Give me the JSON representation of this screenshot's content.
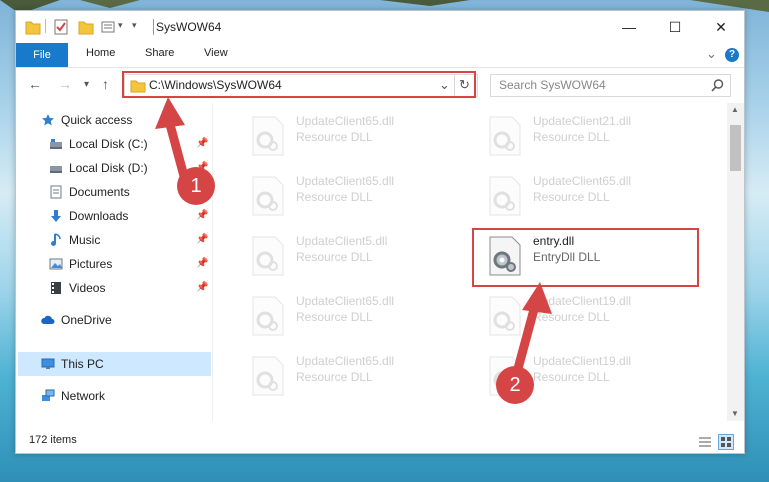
{
  "window": {
    "title": "SysWOW64",
    "controls": {
      "minimize": "—",
      "maximize": "☐",
      "close": "✕"
    }
  },
  "ribbon": {
    "tabs": [
      "File",
      "Home",
      "Share",
      "View"
    ],
    "expand_glyph": "⌄",
    "help_glyph": "?"
  },
  "nav": {
    "back": "←",
    "forward": "→",
    "recent": "▾",
    "up": "↑",
    "address": "C:\\Windows\\SysWOW64",
    "address_dropdown": "⌄",
    "refresh": "↻",
    "search_placeholder": "Search SysWOW64"
  },
  "sidebar": {
    "items": [
      {
        "label": "Quick access",
        "icon": "star-icon",
        "pinned": false
      },
      {
        "label": "Local Disk (C:)",
        "icon": "drive-icon",
        "pinned": true
      },
      {
        "label": "Local Disk (D:)",
        "icon": "drive-icon",
        "pinned": true
      },
      {
        "label": "Documents",
        "icon": "documents-icon",
        "pinned": true
      },
      {
        "label": "Downloads",
        "icon": "download-icon",
        "pinned": true
      },
      {
        "label": "Music",
        "icon": "music-icon",
        "pinned": true
      },
      {
        "label": "Pictures",
        "icon": "pictures-icon",
        "pinned": true
      },
      {
        "label": "Videos",
        "icon": "videos-icon",
        "pinned": true
      },
      {
        "label": "OneDrive",
        "icon": "cloud-icon",
        "pinned": false
      },
      {
        "label": "This PC",
        "icon": "computer-icon",
        "pinned": false,
        "selected": true
      },
      {
        "label": "Network",
        "icon": "network-icon",
        "pinned": false
      }
    ],
    "pin_glyph": "📌"
  },
  "files": [
    {
      "name": "UpdateClient65.dll",
      "type": "Resource DLL",
      "faded": true
    },
    {
      "name": "UpdateClient21.dll",
      "type": "Resource DLL",
      "faded": true
    },
    {
      "name": "UpdateClient65.dll",
      "type": "Resource DLL",
      "faded": true
    },
    {
      "name": "UpdateClient65.dll",
      "type": "Resource DLL",
      "faded": true
    },
    {
      "name": "UpdateClient5.dll",
      "type": "Resource DLL",
      "faded": true
    },
    {
      "name": "entry.dll",
      "type": "EntryDll DLL",
      "faded": false,
      "highlighted": true
    },
    {
      "name": "UpdateClient65.dll",
      "type": "Resource DLL",
      "faded": true
    },
    {
      "name": "UpdateClient19.dll",
      "type": "Resource DLL",
      "faded": true
    },
    {
      "name": "UpdateClient65.dll",
      "type": "Resource DLL",
      "faded": true
    },
    {
      "name": "UpdateClient19.dll",
      "type": "Resource DLL",
      "faded": true
    }
  ],
  "status": {
    "item_count": "172 items"
  },
  "annotations": {
    "callout1": "1",
    "callout2": "2",
    "color": "#d64545"
  }
}
